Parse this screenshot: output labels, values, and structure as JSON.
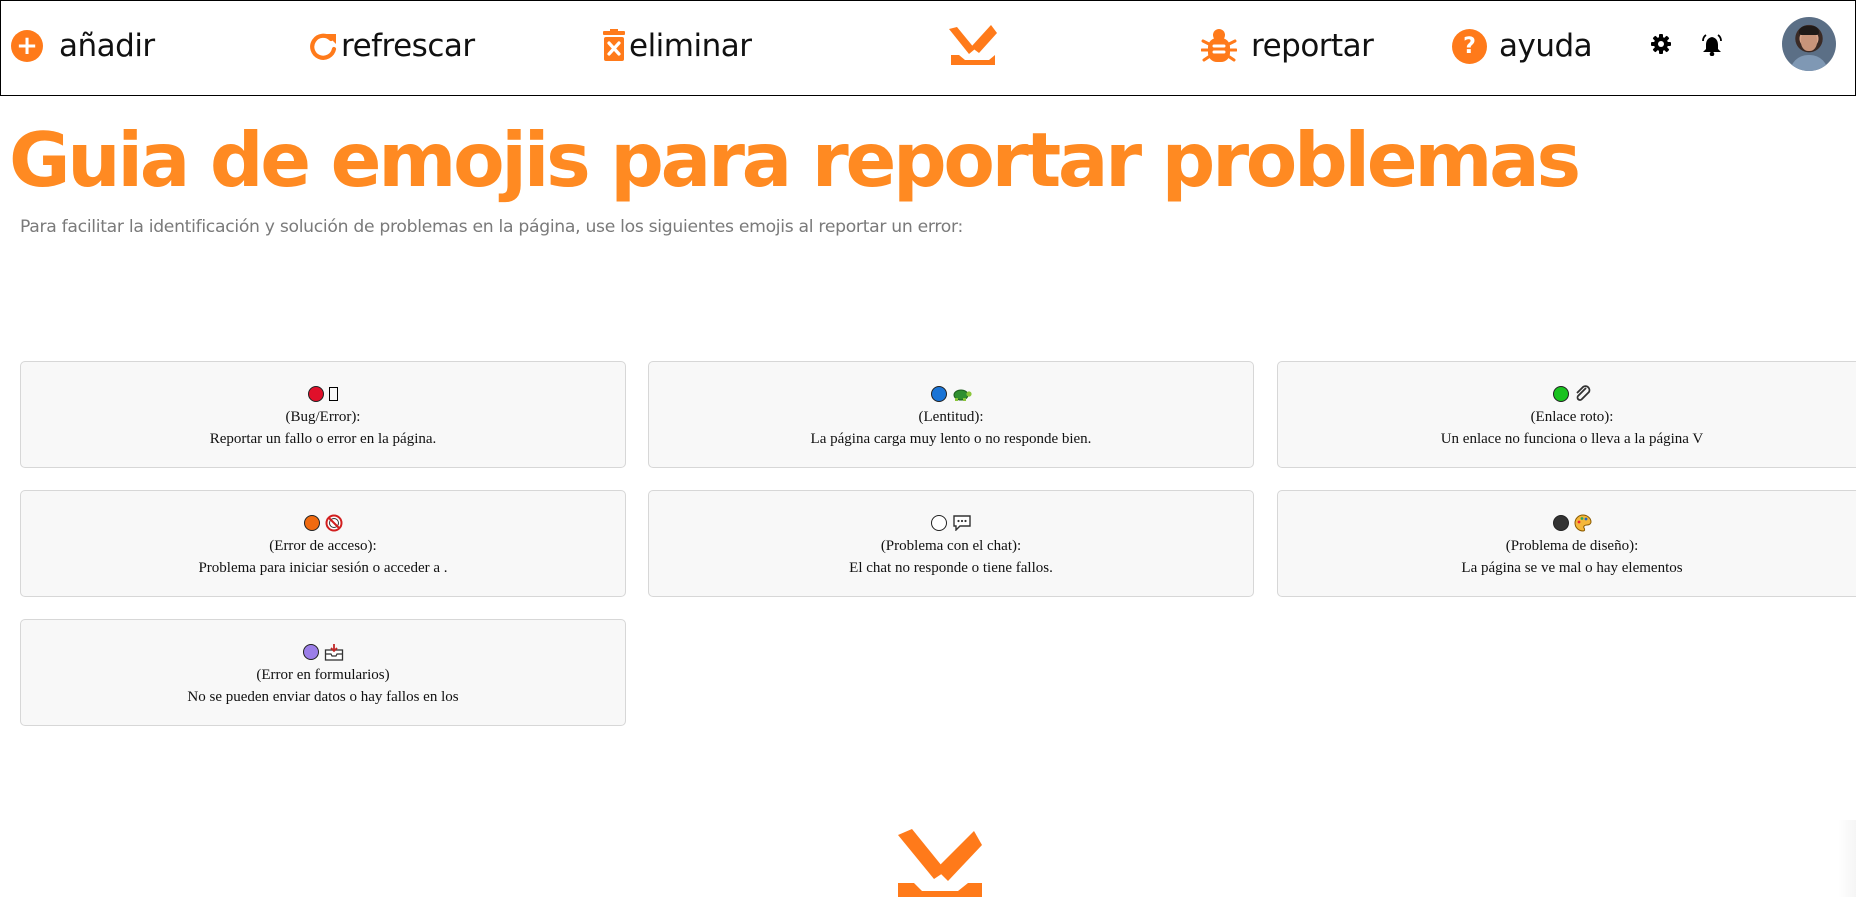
{
  "toolbar": {
    "add_label": "añadir",
    "refresh_label": "refrescar",
    "delete_label": "eliminar",
    "report_label": "reportar",
    "help_label": "ayuda",
    "help_icon_glyph": "?",
    "add_icon_glyph": "+"
  },
  "icons": {
    "add": "plus-circle-icon",
    "refresh": "refresh-icon",
    "delete": "trash-x-icon",
    "logo": "brand-logo-icon",
    "report": "bug-icon",
    "help": "question-circle-icon",
    "settings": "gear-icon",
    "notifications": "bell-icon",
    "avatar": "user-avatar"
  },
  "colors": {
    "accent": "#ff8a22",
    "icon_orange": "#ff7a1a"
  },
  "page": {
    "title": "Guia de emojis para reportar problemas",
    "subtitle": "Para facilitar la identificación y solución de problemas en la página, use los siguientes emojis al reportar un error:"
  },
  "cards": [
    {
      "dot_color": "#e0102a",
      "emoji": "tofu-glyph",
      "label": "(Bug/Error):",
      "desc": "Reportar un fallo o error en la página."
    },
    {
      "dot_color": "#1a74d6",
      "emoji": "turtle-icon",
      "label": "(Lentitud):",
      "desc": "La página carga muy lento o no responde bien."
    },
    {
      "dot_color": "#19c21f",
      "emoji": "paperclip-icon",
      "label": "(Enlace roto):",
      "desc": "Un enlace no funciona o lleva a la página V"
    },
    {
      "dot_color": "#f06a10",
      "emoji": "no-entry-icon",
      "label": "(Error de acceso):",
      "desc": "Problema para iniciar sesión o acceder a ."
    },
    {
      "dot_color": "#ffffff",
      "emoji": "speech-bubble-icon",
      "label": "(Problema con el chat):",
      "desc": "El chat no responde o tiene fallos."
    },
    {
      "dot_color": "#333333",
      "emoji": "palette-icon",
      "label": "(Problema de diseño):",
      "desc": "La página se ve mal o hay elementos"
    },
    {
      "dot_color": "#9b7ee8",
      "emoji": "inbox-tray-icon",
      "label": "(Error en formularios)",
      "desc": "No se pueden enviar datos o hay fallos en los"
    }
  ]
}
